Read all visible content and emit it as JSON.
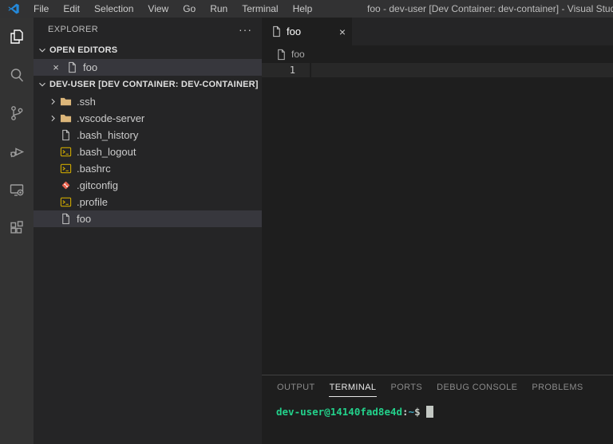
{
  "title_bar": {
    "menus": [
      "File",
      "Edit",
      "Selection",
      "View",
      "Go",
      "Run",
      "Terminal",
      "Help"
    ],
    "window_title": "foo - dev-user [Dev Container: dev-container] - Visual Studio Code"
  },
  "activity_bar": {
    "items": [
      {
        "name": "explorer",
        "icon": "files-icon",
        "active": true
      },
      {
        "name": "search",
        "icon": "search-icon",
        "active": false
      },
      {
        "name": "source-control",
        "icon": "source-control-icon",
        "active": false
      },
      {
        "name": "run-and-debug",
        "icon": "debug-icon",
        "active": false
      },
      {
        "name": "remote-explorer",
        "icon": "remote-explorer-icon",
        "active": false
      },
      {
        "name": "extensions",
        "icon": "extensions-icon",
        "active": false
      }
    ]
  },
  "sidebar": {
    "title": "EXPLORER",
    "more_actions_glyph": "···",
    "open_editors": {
      "label": "OPEN EDITORS",
      "items": [
        {
          "label": "foo",
          "icon": "file-icon",
          "close_glyph": "×",
          "selected": true
        }
      ]
    },
    "workspace": {
      "label": "DEV-USER [DEV CONTAINER: DEV-CONTAINER]",
      "items": [
        {
          "label": ".ssh",
          "icon": "folder-icon",
          "expandable": true
        },
        {
          "label": ".vscode-server",
          "icon": "folder-icon",
          "expandable": true
        },
        {
          "label": ".bash_history",
          "icon": "file-icon"
        },
        {
          "label": ".bash_logout",
          "icon": "shell-icon"
        },
        {
          "label": ".bashrc",
          "icon": "shell-icon"
        },
        {
          "label": ".gitconfig",
          "icon": "git-icon"
        },
        {
          "label": ".profile",
          "icon": "shell-icon"
        },
        {
          "label": "foo",
          "icon": "file-icon",
          "selected": true
        }
      ]
    }
  },
  "editor": {
    "tabs": [
      {
        "label": "foo",
        "icon": "file-icon",
        "close_glyph": "×",
        "active": true
      }
    ],
    "breadcrumb": "foo",
    "lines": [
      {
        "number": "1",
        "content": ""
      }
    ]
  },
  "panel": {
    "tabs": [
      "OUTPUT",
      "TERMINAL",
      "PORTS",
      "DEBUG CONSOLE",
      "PROBLEMS"
    ],
    "active_tab": "TERMINAL",
    "terminal": {
      "user_host": "dev-user@14140fad8e4d",
      "colon": ":",
      "path": "~",
      "prompt_char": "$"
    }
  },
  "colors": {
    "accent_blue": "#007acc",
    "terminal_green": "#23d18b",
    "terminal_path_blue": "#3fa7c0",
    "folder_icon": "#dcb67a",
    "shell_icon": "#cca700",
    "git_icon": "#e8634f",
    "selection_bg": "#37373d"
  }
}
